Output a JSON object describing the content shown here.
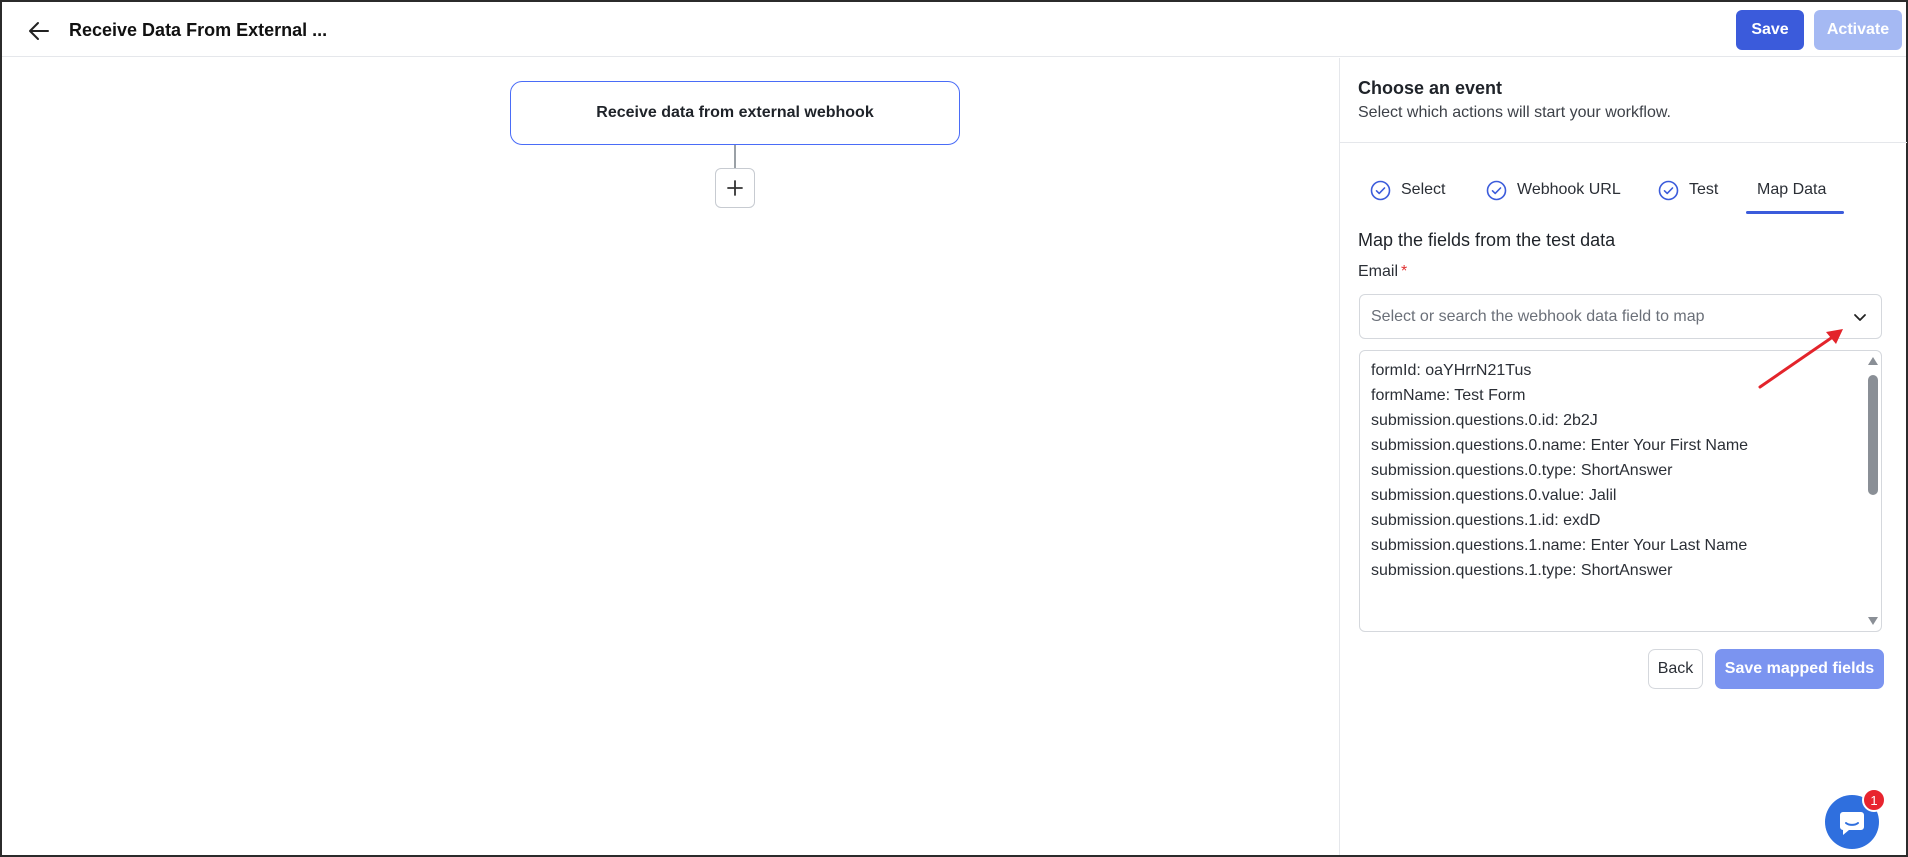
{
  "header": {
    "title": "Receive Data From External ...",
    "save_label": "Save",
    "activate_label": "Activate"
  },
  "canvas": {
    "trigger_node_label": "Receive data from external webhook"
  },
  "panel": {
    "title": "Choose an event",
    "subtitle": "Select which actions will start your workflow.",
    "steps": [
      {
        "label": "Select",
        "status": "complete"
      },
      {
        "label": "Webhook URL",
        "status": "complete"
      },
      {
        "label": "Test",
        "status": "complete"
      },
      {
        "label": "Map Data",
        "status": "active"
      }
    ],
    "section_title": "Map the fields from the test data",
    "field_label": "Email",
    "required_marker": "*",
    "select_placeholder": "Select or search the webhook data field to map",
    "options": [
      "formId: oaYHrrN21Tus",
      "formName: Test Form",
      "submission.questions.0.id: 2b2J",
      "submission.questions.0.name: Enter Your First Name",
      "submission.questions.0.type: ShortAnswer",
      "submission.questions.0.value: Jalil",
      "submission.questions.1.id: exdD",
      "submission.questions.1.name: Enter Your Last Name",
      "submission.questions.1.type: ShortAnswer"
    ],
    "back_label": "Back",
    "save_mapped_label": "Save mapped fields"
  },
  "chat": {
    "badge_count": "1"
  },
  "colors": {
    "primary": "#3b5bdb",
    "primary_disabled": "#a5b9f3",
    "annotation_arrow": "#e3242b",
    "chat": "#2f6fde",
    "badge": "#e8242e"
  },
  "icons": [
    "back-arrow-icon",
    "plus-icon",
    "check-circle-icon",
    "chevron-down-icon",
    "chat-icon"
  ]
}
